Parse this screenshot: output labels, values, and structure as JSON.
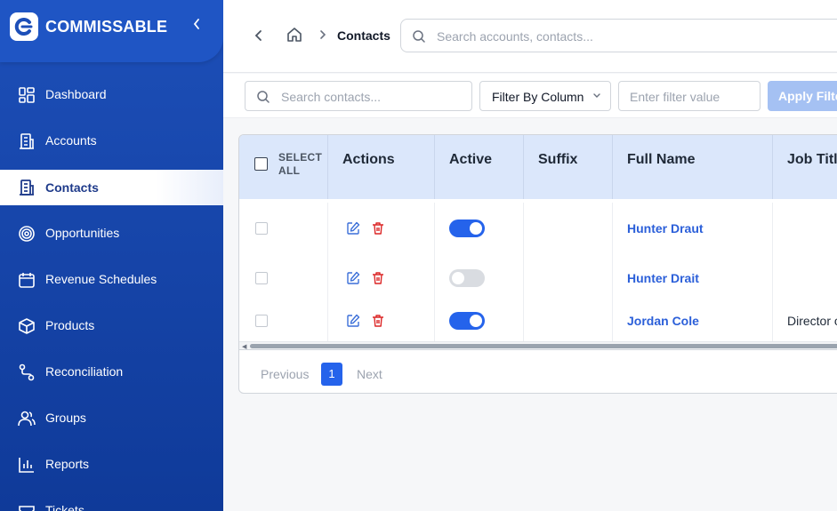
{
  "brand": {
    "name": "COMMISSABLE"
  },
  "sidebar": {
    "items": [
      {
        "label": "Dashboard",
        "icon": "dashboard-icon"
      },
      {
        "label": "Accounts",
        "icon": "building-icon"
      },
      {
        "label": "Contacts",
        "icon": "contacts-icon",
        "active": true
      },
      {
        "label": "Opportunities",
        "icon": "target-icon"
      },
      {
        "label": "Revenue Schedules",
        "icon": "calendar-icon"
      },
      {
        "label": "Products",
        "icon": "box-icon"
      },
      {
        "label": "Reconciliation",
        "icon": "route-icon"
      },
      {
        "label": "Groups",
        "icon": "users-icon"
      },
      {
        "label": "Reports",
        "icon": "bar-chart-icon"
      },
      {
        "label": "Tickets",
        "icon": "ticket-icon"
      }
    ]
  },
  "breadcrumb": {
    "current": "Contacts"
  },
  "global_search": {
    "placeholder": "Search accounts, contacts..."
  },
  "filters": {
    "search_placeholder": "Search contacts...",
    "filter_column": "Filter By Column",
    "value_placeholder": "Enter filter value",
    "apply_label": "Apply Filter"
  },
  "table": {
    "select_all": "SELECT ALL",
    "headers": [
      "Actions",
      "Active",
      "Suffix",
      "Full Name",
      "Job Title"
    ],
    "rows": [
      {
        "active": true,
        "suffix": "",
        "full_name": "Hunter Draut",
        "job_title": ""
      },
      {
        "active": false,
        "suffix": "",
        "full_name": "Hunter Drait",
        "job_title": ""
      },
      {
        "active": true,
        "suffix": "",
        "full_name": "Jordan Cole",
        "job_title": "Director of Sales"
      }
    ]
  },
  "pagination": {
    "previous": "Previous",
    "current": "1",
    "next": "Next"
  },
  "colors": {
    "sidebar": "#1d4fb8",
    "accent": "#2563eb",
    "header_bg": "#dbe7fb",
    "delete": "#dc2626",
    "link": "#2b5fd9"
  }
}
